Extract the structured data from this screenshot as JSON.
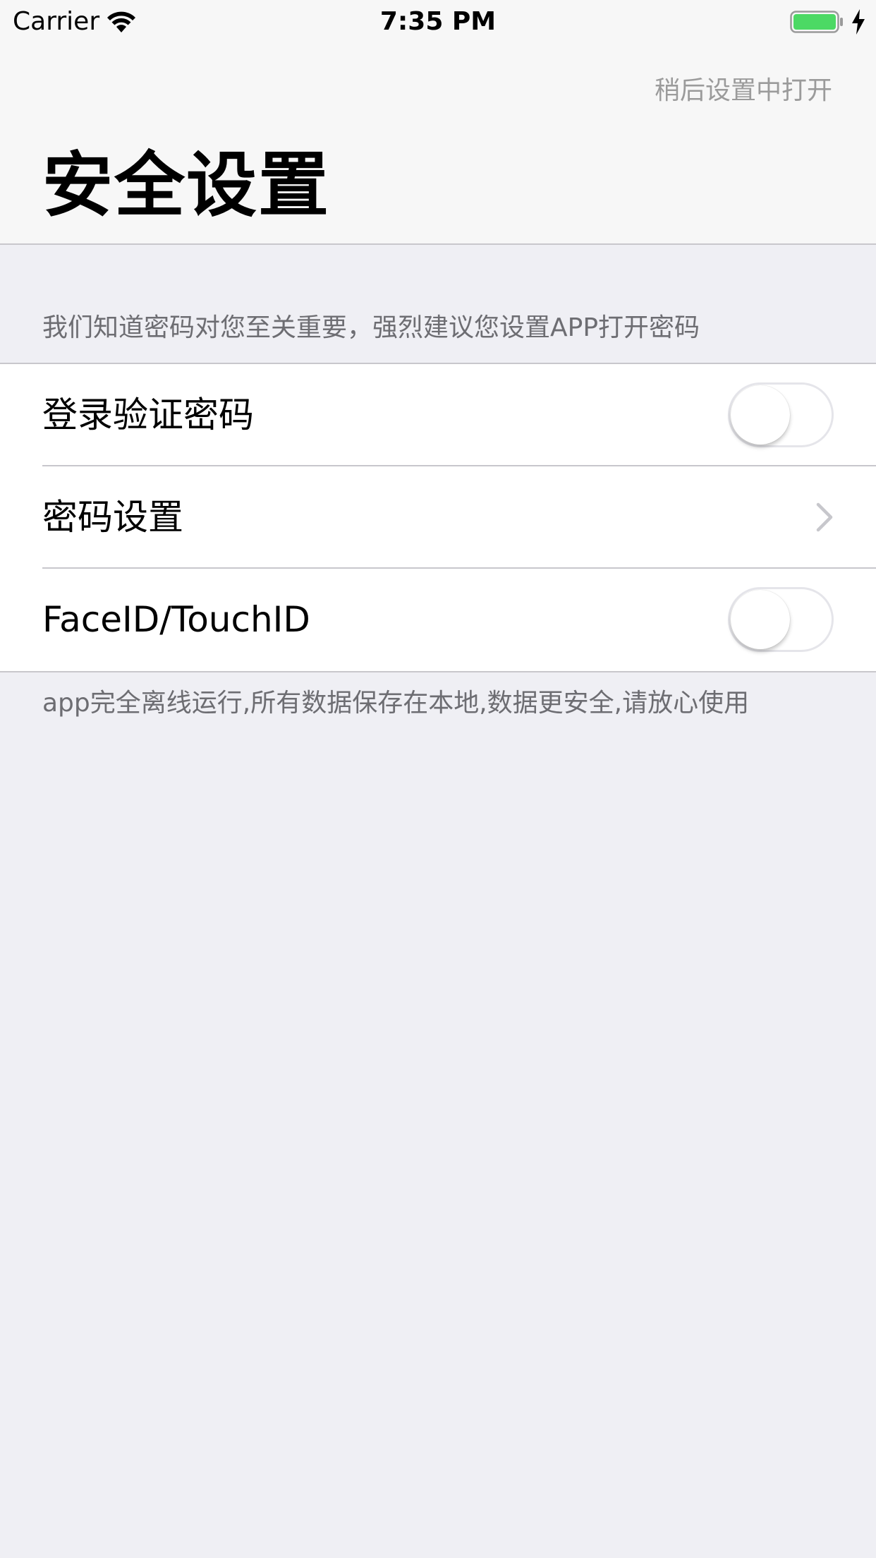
{
  "status_bar": {
    "carrier": "Carrier",
    "time": "7:35 PM",
    "battery_color": "#4cd964",
    "icons": [
      "wifi-icon",
      "battery-icon",
      "charging-icon"
    ]
  },
  "nav": {
    "action_label": "稍后设置中打开",
    "title": "安全设置"
  },
  "section": {
    "header": "我们知道密码对您至关重要，强烈建议您设置APP打开密码",
    "rows": [
      {
        "label": "登录验证密码",
        "accessory": "toggle",
        "on": false
      },
      {
        "label": "密码设置",
        "accessory": "chevron-right-icon"
      },
      {
        "label": "FaceID/TouchID",
        "accessory": "toggle",
        "on": false
      }
    ],
    "footer": "app完全离线运行,所有数据保存在本地,数据更安全,请放心使用"
  },
  "colors": {
    "background": "#efeff4",
    "cell_background": "#ffffff",
    "secondary_text": "#6d6d72",
    "action_text": "#9b9b9b",
    "separator": "#c8c7cc"
  }
}
